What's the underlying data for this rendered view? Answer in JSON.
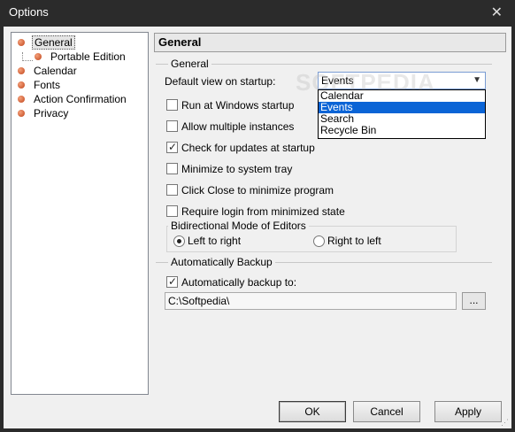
{
  "window": {
    "title": "Options"
  },
  "tree": {
    "items": [
      {
        "label": "General",
        "selected": true,
        "indent": 0
      },
      {
        "label": "Portable Edition",
        "selected": false,
        "indent": 1
      },
      {
        "label": "Calendar",
        "selected": false,
        "indent": 0
      },
      {
        "label": "Fonts",
        "selected": false,
        "indent": 0
      },
      {
        "label": "Action Confirmation",
        "selected": false,
        "indent": 0
      },
      {
        "label": "Privacy",
        "selected": false,
        "indent": 0
      }
    ]
  },
  "panel": {
    "header": "General"
  },
  "general": {
    "group_label": "General",
    "default_view_label": "Default view on startup:",
    "default_view_value": "Events",
    "default_view_options": [
      "Calendar",
      "Events",
      "Search",
      "Recycle Bin"
    ],
    "checkboxes": [
      {
        "label": "Run at Windows startup",
        "checked": false
      },
      {
        "label": "Allow multiple instances",
        "checked": false
      },
      {
        "label": "Check for updates at startup",
        "checked": true
      },
      {
        "label": "Minimize to system tray",
        "checked": false
      },
      {
        "label": "Click Close to minimize program",
        "checked": false
      },
      {
        "label": "Require login from minimized state",
        "checked": false
      }
    ],
    "bidi": {
      "label": "Bidirectional Mode of Editors",
      "options": [
        {
          "label": "Left to right",
          "selected": true
        },
        {
          "label": "Right to left",
          "selected": false
        }
      ]
    }
  },
  "backup": {
    "group_label": "Automatically Backup",
    "checkbox_label": "Automatically backup to:",
    "checked": true,
    "path": "C:\\Softpedia\\",
    "browse_label": "..."
  },
  "buttons": {
    "ok": "OK",
    "cancel": "Cancel",
    "apply": "Apply"
  },
  "watermark": "SOFTPEDIA",
  "colors": {
    "selection": "#0a64d6",
    "bullet": "#c0441a",
    "titlebar": "#2b2b2b"
  }
}
